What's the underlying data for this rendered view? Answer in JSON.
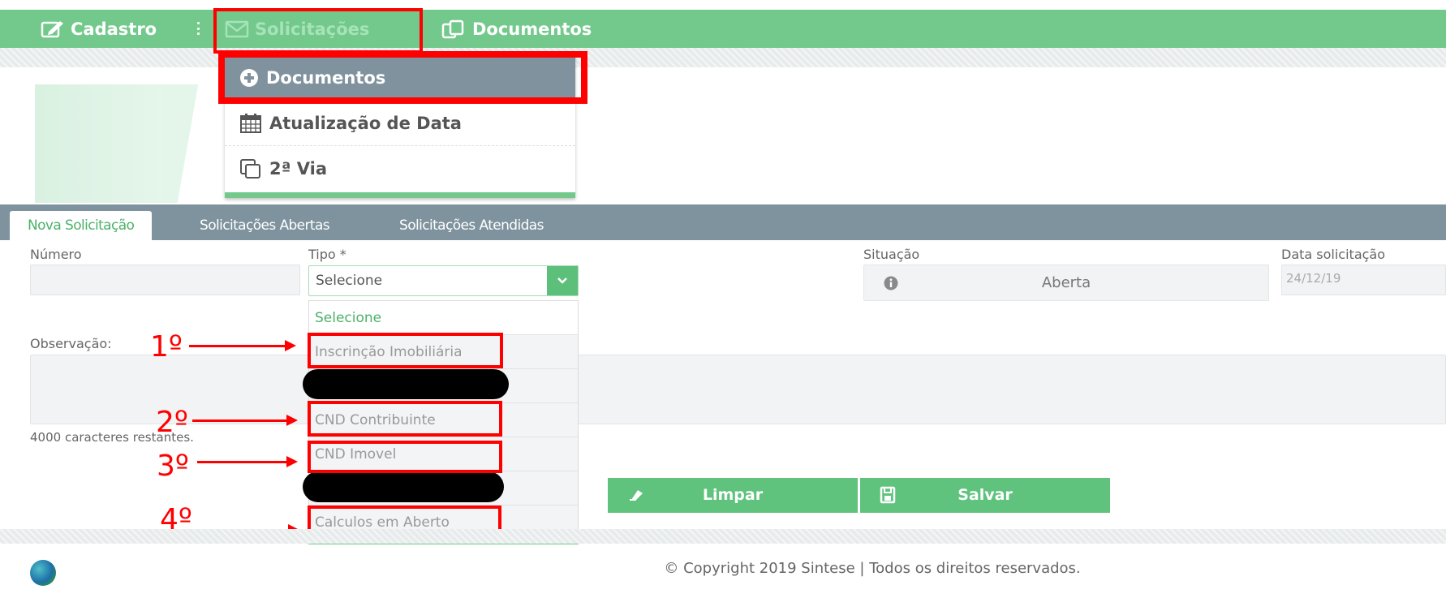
{
  "topnav": {
    "items": [
      {
        "label": "Cadastro",
        "icon": "edit-icon"
      },
      {
        "label": "Solicitações",
        "icon": "envelope-icon"
      },
      {
        "label": "Documentos",
        "icon": "copy-icon"
      }
    ]
  },
  "submenu": {
    "items": [
      {
        "label": "Documentos",
        "icon": "plus-circle-icon"
      },
      {
        "label": "Atualização de Data",
        "icon": "calendar-icon"
      },
      {
        "label": "2ª Via",
        "icon": "clone-icon"
      }
    ]
  },
  "tabs": [
    "Nova Solicitação",
    "Solicitações Abertas",
    "Solicitações Atendidas"
  ],
  "form": {
    "numero_label": "Número",
    "numero_value": "",
    "tipo_label": "Tipo *",
    "tipo_value": "Selecione",
    "situacao_label": "Situação",
    "situacao_value": "Aberta",
    "data_label": "Data solicitação",
    "data_value": "24/12/19",
    "observacao_label": "Observação:",
    "chars_remaining": "4000 caracteres restantes."
  },
  "dropdown": {
    "options": [
      "Selecione",
      "Inscrinção Imobiliária",
      "",
      "CND Contribuinte",
      "CND Imovel",
      "",
      "Calculos em Aberto"
    ]
  },
  "annotations": [
    "1º",
    "2º",
    "3º",
    "4º"
  ],
  "buttons": {
    "clear": "Limpar",
    "save": "Salvar"
  },
  "footer": {
    "copyright": "© Copyright 2019 Sintese | Todos os direitos reservados."
  },
  "colors": {
    "accent": "#72c98b",
    "tabbar": "#7f939e",
    "highlight": "#ff0000"
  }
}
